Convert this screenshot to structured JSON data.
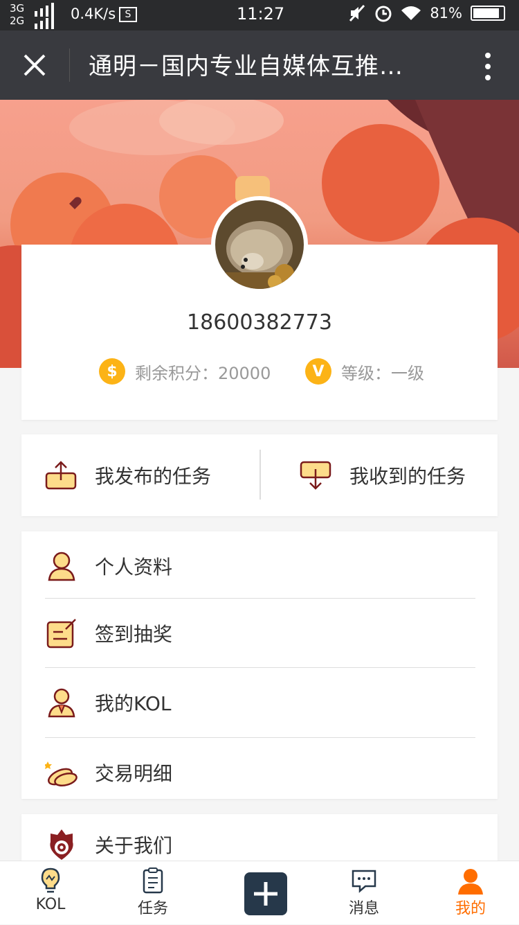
{
  "status_bar": {
    "network_top": "3G",
    "network_bottom": "2G",
    "speed": "0.4K/s",
    "speed_icon": "S",
    "time": "11:27",
    "battery": "81%"
  },
  "title_bar": {
    "title": "通明－国内专业自媒体互推…"
  },
  "profile": {
    "phone": "18600382773",
    "points_label": "剩余积分：20000",
    "level_label": "等级：一级",
    "coin_symbol": "$",
    "level_symbol": "V"
  },
  "tasks": {
    "published": "我发布的任务",
    "received": "我收到的任务"
  },
  "menu": {
    "items": [
      {
        "label": "个人资料"
      },
      {
        "label": "签到抽奖"
      },
      {
        "label": "我的KOL"
      },
      {
        "label": "交易明细"
      },
      {
        "label": "关于我们"
      }
    ]
  },
  "tabbar": {
    "kol": "KOL",
    "task": "任务",
    "message": "消息",
    "mine": "我的"
  },
  "colors": {
    "accent": "#ff6d00",
    "coin": "#fcb316",
    "titlebar": "#393a3f",
    "icon_outline": "#7a1b1b",
    "icon_fill": "#fddc8a"
  }
}
